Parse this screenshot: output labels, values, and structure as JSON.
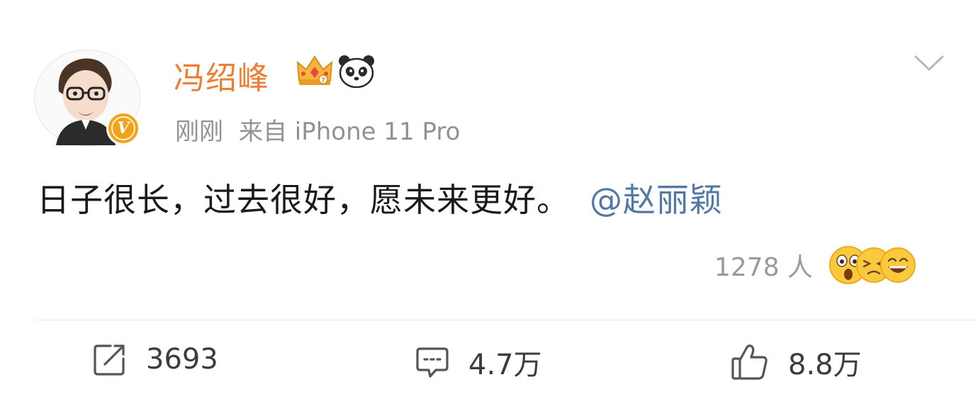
{
  "post": {
    "author": {
      "name": "冯绍峰",
      "avatar_icon": "avatar-illustration",
      "verified_badge_text": "V",
      "badge_icons": [
        "crown-icon",
        "panda-icon"
      ]
    },
    "meta": {
      "time": "刚刚",
      "source": "来自 iPhone 11 Pro"
    },
    "text": "日子很长，过去很好，愿未来更好。",
    "mention": "@赵丽颖",
    "reactions": {
      "count_text": "1278 人",
      "emoji_icons": [
        "surprised-emoji",
        "dizzy-emoji",
        "laughing-emoji"
      ]
    },
    "actions": {
      "repost": {
        "icon": "repost-icon",
        "count": "3693"
      },
      "comment": {
        "icon": "comment-icon",
        "count": "4.7万"
      },
      "like": {
        "icon": "thumbs-up-icon",
        "count": "8.8万"
      }
    },
    "menu_icon": "chevron-down-icon"
  },
  "colors": {
    "username": "#ef7d31",
    "mention": "#5278a5",
    "meta_text": "#929292",
    "verified_badge": "#f3a31b"
  }
}
